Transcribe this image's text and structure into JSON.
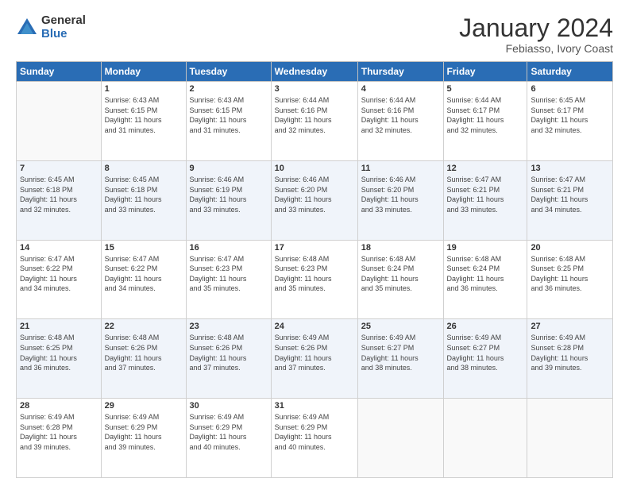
{
  "logo": {
    "general": "General",
    "blue": "Blue"
  },
  "header": {
    "title": "January 2024",
    "location": "Febiasso, Ivory Coast"
  },
  "days_of_week": [
    "Sunday",
    "Monday",
    "Tuesday",
    "Wednesday",
    "Thursday",
    "Friday",
    "Saturday"
  ],
  "weeks": [
    [
      {
        "day": "",
        "info": ""
      },
      {
        "day": "1",
        "info": "Sunrise: 6:43 AM\nSunset: 6:15 PM\nDaylight: 11 hours\nand 31 minutes."
      },
      {
        "day": "2",
        "info": "Sunrise: 6:43 AM\nSunset: 6:15 PM\nDaylight: 11 hours\nand 31 minutes."
      },
      {
        "day": "3",
        "info": "Sunrise: 6:44 AM\nSunset: 6:16 PM\nDaylight: 11 hours\nand 32 minutes."
      },
      {
        "day": "4",
        "info": "Sunrise: 6:44 AM\nSunset: 6:16 PM\nDaylight: 11 hours\nand 32 minutes."
      },
      {
        "day": "5",
        "info": "Sunrise: 6:44 AM\nSunset: 6:17 PM\nDaylight: 11 hours\nand 32 minutes."
      },
      {
        "day": "6",
        "info": "Sunrise: 6:45 AM\nSunset: 6:17 PM\nDaylight: 11 hours\nand 32 minutes."
      }
    ],
    [
      {
        "day": "7",
        "info": "Sunrise: 6:45 AM\nSunset: 6:18 PM\nDaylight: 11 hours\nand 32 minutes."
      },
      {
        "day": "8",
        "info": "Sunrise: 6:45 AM\nSunset: 6:18 PM\nDaylight: 11 hours\nand 33 minutes."
      },
      {
        "day": "9",
        "info": "Sunrise: 6:46 AM\nSunset: 6:19 PM\nDaylight: 11 hours\nand 33 minutes."
      },
      {
        "day": "10",
        "info": "Sunrise: 6:46 AM\nSunset: 6:20 PM\nDaylight: 11 hours\nand 33 minutes."
      },
      {
        "day": "11",
        "info": "Sunrise: 6:46 AM\nSunset: 6:20 PM\nDaylight: 11 hours\nand 33 minutes."
      },
      {
        "day": "12",
        "info": "Sunrise: 6:47 AM\nSunset: 6:21 PM\nDaylight: 11 hours\nand 33 minutes."
      },
      {
        "day": "13",
        "info": "Sunrise: 6:47 AM\nSunset: 6:21 PM\nDaylight: 11 hours\nand 34 minutes."
      }
    ],
    [
      {
        "day": "14",
        "info": "Sunrise: 6:47 AM\nSunset: 6:22 PM\nDaylight: 11 hours\nand 34 minutes."
      },
      {
        "day": "15",
        "info": "Sunrise: 6:47 AM\nSunset: 6:22 PM\nDaylight: 11 hours\nand 34 minutes."
      },
      {
        "day": "16",
        "info": "Sunrise: 6:47 AM\nSunset: 6:23 PM\nDaylight: 11 hours\nand 35 minutes."
      },
      {
        "day": "17",
        "info": "Sunrise: 6:48 AM\nSunset: 6:23 PM\nDaylight: 11 hours\nand 35 minutes."
      },
      {
        "day": "18",
        "info": "Sunrise: 6:48 AM\nSunset: 6:24 PM\nDaylight: 11 hours\nand 35 minutes."
      },
      {
        "day": "19",
        "info": "Sunrise: 6:48 AM\nSunset: 6:24 PM\nDaylight: 11 hours\nand 36 minutes."
      },
      {
        "day": "20",
        "info": "Sunrise: 6:48 AM\nSunset: 6:25 PM\nDaylight: 11 hours\nand 36 minutes."
      }
    ],
    [
      {
        "day": "21",
        "info": "Sunrise: 6:48 AM\nSunset: 6:25 PM\nDaylight: 11 hours\nand 36 minutes."
      },
      {
        "day": "22",
        "info": "Sunrise: 6:48 AM\nSunset: 6:26 PM\nDaylight: 11 hours\nand 37 minutes."
      },
      {
        "day": "23",
        "info": "Sunrise: 6:48 AM\nSunset: 6:26 PM\nDaylight: 11 hours\nand 37 minutes."
      },
      {
        "day": "24",
        "info": "Sunrise: 6:49 AM\nSunset: 6:26 PM\nDaylight: 11 hours\nand 37 minutes."
      },
      {
        "day": "25",
        "info": "Sunrise: 6:49 AM\nSunset: 6:27 PM\nDaylight: 11 hours\nand 38 minutes."
      },
      {
        "day": "26",
        "info": "Sunrise: 6:49 AM\nSunset: 6:27 PM\nDaylight: 11 hours\nand 38 minutes."
      },
      {
        "day": "27",
        "info": "Sunrise: 6:49 AM\nSunset: 6:28 PM\nDaylight: 11 hours\nand 39 minutes."
      }
    ],
    [
      {
        "day": "28",
        "info": "Sunrise: 6:49 AM\nSunset: 6:28 PM\nDaylight: 11 hours\nand 39 minutes."
      },
      {
        "day": "29",
        "info": "Sunrise: 6:49 AM\nSunset: 6:29 PM\nDaylight: 11 hours\nand 39 minutes."
      },
      {
        "day": "30",
        "info": "Sunrise: 6:49 AM\nSunset: 6:29 PM\nDaylight: 11 hours\nand 40 minutes."
      },
      {
        "day": "31",
        "info": "Sunrise: 6:49 AM\nSunset: 6:29 PM\nDaylight: 11 hours\nand 40 minutes."
      },
      {
        "day": "",
        "info": ""
      },
      {
        "day": "",
        "info": ""
      },
      {
        "day": "",
        "info": ""
      }
    ]
  ]
}
